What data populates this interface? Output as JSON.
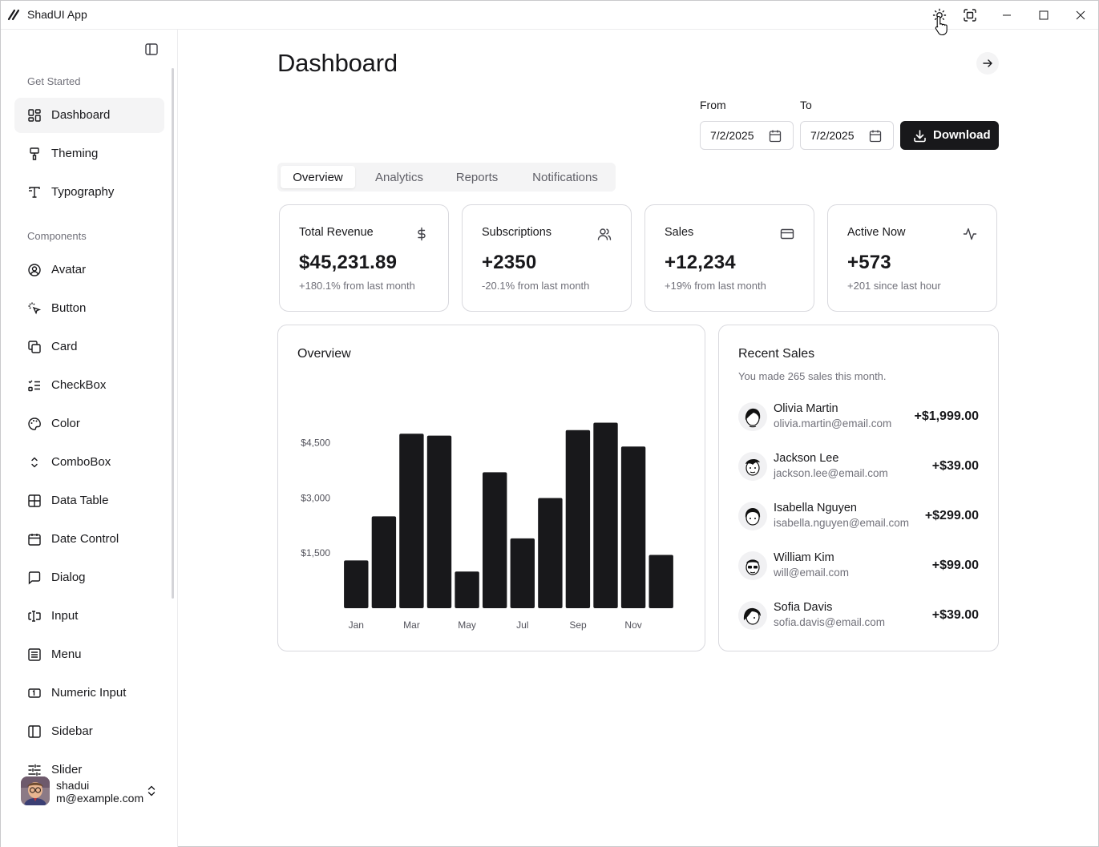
{
  "window": {
    "title": "ShadUI App"
  },
  "sidebar": {
    "groups": [
      {
        "label": "Get Started"
      },
      {
        "label": "Components"
      }
    ],
    "items": [
      {
        "label": "Dashboard",
        "icon": "dashboard-icon",
        "active": true
      },
      {
        "label": "Theming",
        "icon": "paint-roller-icon"
      },
      {
        "label": "Typography",
        "icon": "typography-icon"
      },
      {
        "label": "Avatar",
        "icon": "avatar-icon"
      },
      {
        "label": "Button",
        "icon": "pointer-click-icon"
      },
      {
        "label": "Card",
        "icon": "card-copy-icon"
      },
      {
        "label": "CheckBox",
        "icon": "checklist-icon"
      },
      {
        "label": "Color",
        "icon": "palette-icon"
      },
      {
        "label": "ComboBox",
        "icon": "chevrons-up-down-icon"
      },
      {
        "label": "Data Table",
        "icon": "table-icon"
      },
      {
        "label": "Date Control",
        "icon": "calendar-icon"
      },
      {
        "label": "Dialog",
        "icon": "message-square-icon"
      },
      {
        "label": "Input",
        "icon": "text-cursor-input-icon"
      },
      {
        "label": "Menu",
        "icon": "menu-list-icon"
      },
      {
        "label": "Numeric Input",
        "icon": "numeric-input-icon"
      },
      {
        "label": "Sidebar",
        "icon": "sidebar-panel-icon"
      },
      {
        "label": "Slider",
        "icon": "sliders-icon"
      }
    ],
    "user": {
      "name": "shadui",
      "email": "m@example.com"
    }
  },
  "main": {
    "title": "Dashboard",
    "date_range": {
      "from_label": "From",
      "to_label": "To",
      "from_value": "7/2/2025",
      "to_value": "7/2/2025"
    },
    "download_label": "Download",
    "tabs": [
      {
        "label": "Overview",
        "active": true
      },
      {
        "label": "Analytics"
      },
      {
        "label": "Reports"
      },
      {
        "label": "Notifications"
      }
    ],
    "stats": [
      {
        "title": "Total Revenue",
        "value": "$45,231.89",
        "sub": "+180.1% from last month",
        "icon": "dollar-icon"
      },
      {
        "title": "Subscriptions",
        "value": "+2350",
        "sub": "-20.1% from last month",
        "icon": "users-icon"
      },
      {
        "title": "Sales",
        "value": "+12,234",
        "sub": "+19% from last month",
        "icon": "credit-card-icon"
      },
      {
        "title": "Active Now",
        "value": "+573",
        "sub": "+201 since last hour",
        "icon": "activity-icon"
      }
    ],
    "overview": {
      "title": "Overview"
    },
    "recent_sales": {
      "title": "Recent Sales",
      "subtitle": "You made 265 sales this month.",
      "items": [
        {
          "name": "Olivia Martin",
          "email": "olivia.martin@email.com",
          "amount": "+$1,999.00"
        },
        {
          "name": "Jackson Lee",
          "email": "jackson.lee@email.com",
          "amount": "+$39.00"
        },
        {
          "name": "Isabella Nguyen",
          "email": "isabella.nguyen@email.com",
          "amount": "+$299.00"
        },
        {
          "name": "William Kim",
          "email": "will@email.com",
          "amount": "+$99.00"
        },
        {
          "name": "Sofia Davis",
          "email": "sofia.davis@email.com",
          "amount": "+$39.00"
        }
      ]
    }
  },
  "chart_data": {
    "type": "bar",
    "categories": [
      "Jan",
      "Feb",
      "Mar",
      "Apr",
      "May",
      "Jun",
      "Jul",
      "Aug",
      "Sep",
      "Oct",
      "Nov",
      "Dec"
    ],
    "tick_labels_shown": [
      "Jan",
      "Mar",
      "May",
      "Jul",
      "Sep",
      "Nov"
    ],
    "values": [
      1300,
      2500,
      4750,
      4700,
      1000,
      3700,
      1900,
      3000,
      4850,
      5050,
      4400,
      1450
    ],
    "y_ticks": [
      "$1,500",
      "$3,000",
      "$4,500"
    ],
    "y_tick_values": [
      1500,
      3000,
      4500
    ],
    "ylim": [
      0,
      5500
    ],
    "bar_color": "#18181b",
    "grid": false
  },
  "colors": {
    "accent": "#18181b",
    "muted_text": "#71717a",
    "border": "#d9d9de",
    "muted_bg": "#f4f4f5"
  }
}
